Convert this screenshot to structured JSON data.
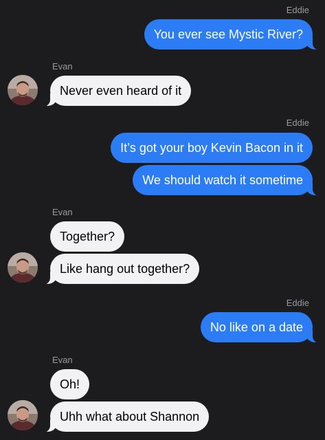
{
  "conversation": {
    "sender_out": "Eddie",
    "sender_in": "Evan",
    "messages": [
      {
        "text": "You ever see Mystic River?"
      },
      {
        "text": "Never even heard of it"
      },
      {
        "text": "It’s got your boy Kevin Bacon in it"
      },
      {
        "text": "We should watch it sometime"
      },
      {
        "text": "Together?"
      },
      {
        "text": "Like hang out together?"
      },
      {
        "text": "No like on a date"
      },
      {
        "text": "Oh!"
      },
      {
        "text": "Uhh what about Shannon"
      }
    ]
  },
  "colors": {
    "background": "#1c1c1e",
    "outgoing_bubble": "#2c7cf6",
    "incoming_bubble": "#f2f2f4",
    "sender_label": "#9a9aa0"
  },
  "icons": {
    "avatar": "contact-photo-icon"
  }
}
